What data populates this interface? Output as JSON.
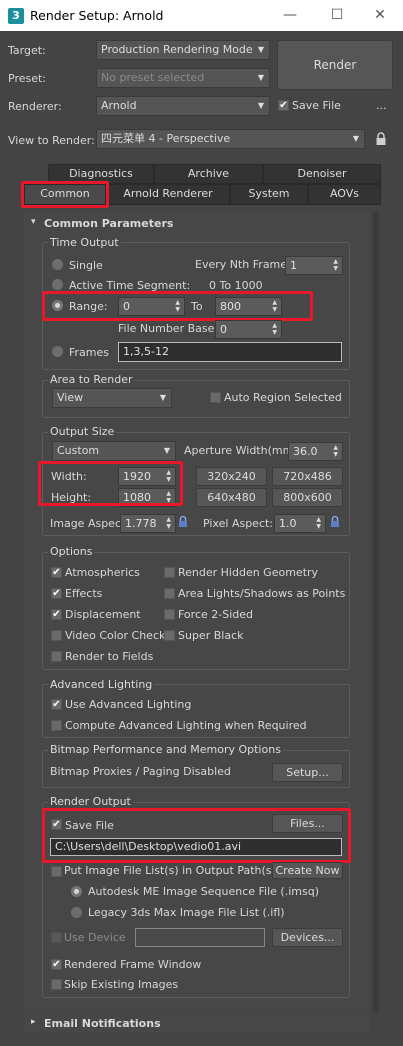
{
  "window": {
    "title": "Render Setup: Arnold",
    "app_icon": "3",
    "minimize": "—",
    "maximize": "☐",
    "close": "✕"
  },
  "top": {
    "target_label": "Target:",
    "target_value": "Production Rendering Mode",
    "preset_label": "Preset:",
    "preset_value": "No preset selected",
    "renderer_label": "Renderer:",
    "renderer_value": "Arnold",
    "save_file_label": "Save File",
    "more_label": "...",
    "render_button": "Render",
    "view_label": "View to Render:",
    "view_value": "四元菜单 4 - Perspective"
  },
  "tabs_row1": [
    "Diagnostics",
    "Archive",
    "Denoiser"
  ],
  "tabs_row2": [
    "Common",
    "Arnold Renderer",
    "System",
    "AOVs"
  ],
  "rollout": {
    "title": "Common Parameters",
    "bottom_title": "Email Notifications"
  },
  "time_output": {
    "title": "Time Output",
    "single": "Single",
    "every_nth_label": "Every Nth Frame:",
    "every_nth_value": "1",
    "active_segment": "Active Time Segment:",
    "active_segment_value": "0 To 1000",
    "range": "Range:",
    "range_from": "0",
    "range_to_label": "To",
    "range_to": "800",
    "file_number_base_label": "File Number Base:",
    "file_number_base": "0",
    "frames": "Frames",
    "frames_value": "1,3,5-12"
  },
  "area_to_render": {
    "title": "Area to Render",
    "value": "View",
    "auto_region": "Auto Region Selected"
  },
  "output_size": {
    "title": "Output Size",
    "preset": "Custom",
    "aperture_label": "Aperture Width(mm):",
    "aperture_value": "36.0",
    "width_label": "Width:",
    "width_value": "1920",
    "height_label": "Height:",
    "height_value": "1080",
    "presets": [
      "320x240",
      "720x486",
      "640x480",
      "800x600"
    ],
    "image_aspect_label": "Image Aspect:",
    "image_aspect_value": "1.778",
    "pixel_aspect_label": "Pixel Aspect:",
    "pixel_aspect_value": "1.0"
  },
  "options": {
    "title": "Options",
    "atmospherics": "Atmospherics",
    "render_hidden": "Render Hidden Geometry",
    "effects": "Effects",
    "area_lights": "Area Lights/Shadows as Points",
    "displacement": "Displacement",
    "force_2sided": "Force 2-Sided",
    "video_color": "Video Color Check",
    "super_black": "Super Black",
    "render_fields": "Render to Fields"
  },
  "advanced_lighting": {
    "title": "Advanced Lighting",
    "use": "Use Advanced Lighting",
    "compute": "Compute Advanced Lighting when Required"
  },
  "bitmap": {
    "title": "Bitmap Performance and Memory Options",
    "status": "Bitmap Proxies / Paging Disabled",
    "setup": "Setup..."
  },
  "render_output": {
    "title": "Render Output",
    "save_file": "Save File",
    "files_button": "Files...",
    "path": "C:\\Users\\dell\\Desktop\\vedio01.avi",
    "put_image_list": "Put Image File List(s) in Output Path(s)",
    "create_now": "Create Now",
    "autodesk_me": "Autodesk ME Image Sequence File (.imsq)",
    "legacy": "Legacy 3ds Max Image File List (.ifl)",
    "use_device": "Use Device",
    "devices_button": "Devices...",
    "rendered_frame_window": "Rendered Frame Window",
    "skip_existing": "Skip Existing Images"
  },
  "icons": {
    "check": "✔",
    "dropdown": "▾",
    "spinner": "▴▾",
    "lock": "lock-icon",
    "collapse": "▾",
    "expand": "▸"
  },
  "colors": {
    "highlight": "#e8182a",
    "background": "#444444"
  }
}
